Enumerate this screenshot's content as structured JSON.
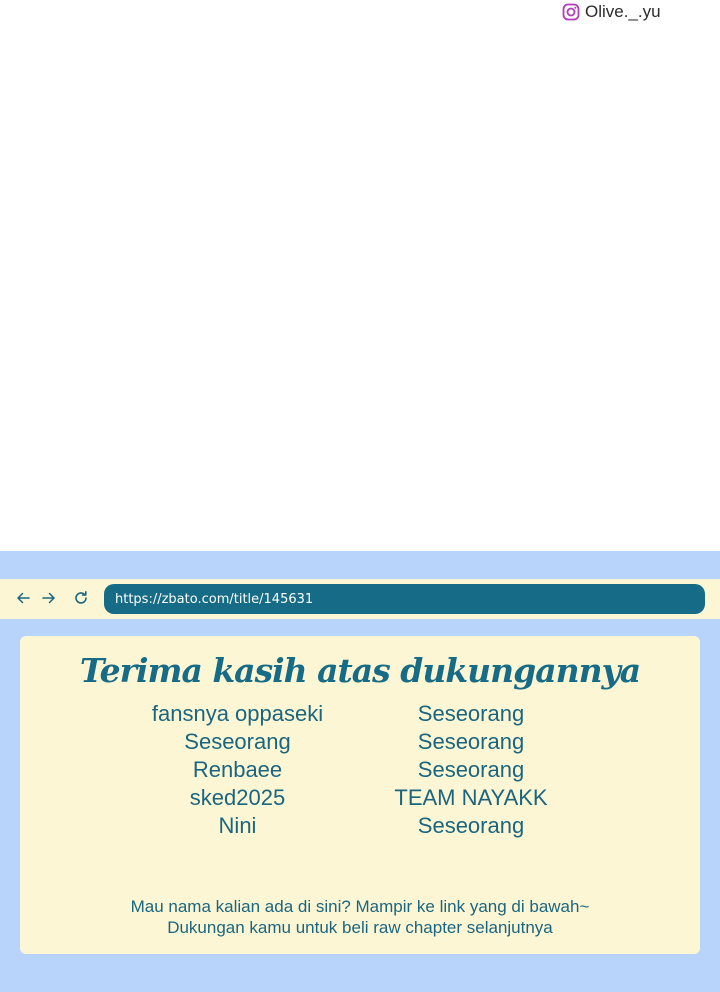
{
  "watermark": {
    "icon": "instagram-icon",
    "handle": "Olive._.yu"
  },
  "browser": {
    "back_icon": "arrow-left-icon",
    "forward_icon": "arrow-right-icon",
    "reload_icon": "reload-icon",
    "url": "https://zbato.com/title/145631"
  },
  "card": {
    "title": "Terima kasih atas dukungannya",
    "left_names": [
      "fansnya oppaseki",
      "Seseorang",
      "Renbaee",
      "sked2025",
      "Nini"
    ],
    "right_names": [
      "Seseorang",
      "Seseorang",
      "Seseorang",
      "TEAM NAYAKK",
      "Seseorang"
    ],
    "footer_line1": "Mau nama kalian ada di sini? Mampir ke link yang di bawah~",
    "footer_line2": "Dukungan kamu untuk beli raw chapter selanjutnya"
  },
  "colors": {
    "panel_blue": "#b8d4fb",
    "cream": "#fdf6d4",
    "teal": "#166b86"
  }
}
